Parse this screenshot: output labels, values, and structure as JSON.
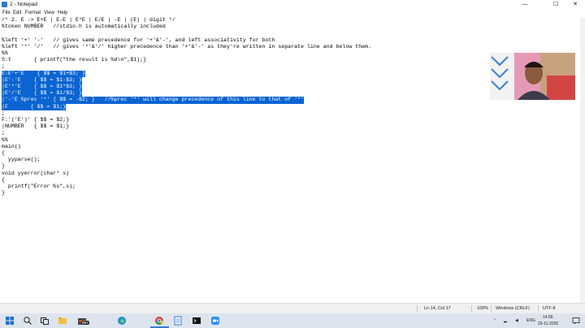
{
  "window": {
    "title": "2 - Notepad",
    "controls": [
      "—",
      "☐",
      "✕"
    ]
  },
  "menu": [
    "File",
    "Edit",
    "Format",
    "View",
    "Help"
  ],
  "editor": {
    "lines": [
      "/* 2. E -> E+E | E-E | E*E | E/E | -E | (E) | digit */",
      "%token NUMBER   //stdio.h is automatically included",
      "",
      "%left '+' '-'   // gives same precedence for '+'&'-', and left associativity for both",
      "%left '*' '/'   // gives '*'&'/' higher precedence than '+'&'-' as they're written in separate line and below them.",
      "%%",
      "S:t       { printf(\"the result is %d\\n\",$1);}",
      ";",
      "E:E'+'E    { $$ = $1+$3; }",
      "|E'-'E    { $$ = $1-$3; }",
      "|E'*'E    { $$ = $1*$3; }",
      "|E'/'E    { $$ = $1/$3; }",
      "|'-'E %prec '*' { $$ = -$2; }   //%prec '*' will change precedence of this line to that of '*'",
      "|F       { $$ = $1;}",
      ";",
      "F:'('E')' { $$ = $2;}",
      "|NUMBER   { $$ = $1;}",
      ";",
      "%%",
      "main()",
      "{",
      "  yyparse();",
      "}",
      "void yyerror(char* s)",
      "{",
      "  printf(\"Error %s\",s);",
      "}"
    ]
  },
  "status": {
    "position": "Ln 14, Col 17",
    "zoom": "100%",
    "line_ending": "Windows (CRLF)",
    "encoding": "UTF-8"
  },
  "taskbar": {
    "icons": [
      "windows-start-icon",
      "search-icon",
      "task-view-icon",
      "file-explorer-icon",
      "store-icon",
      "edge-icon",
      "chrome-icon",
      "notepad-icon",
      "terminal-icon",
      "zoom-icon"
    ],
    "badge": "99+",
    "lang": "ENG",
    "time": "14:56",
    "date": "29-11-2020"
  },
  "colors": {
    "selection": "#0a64d2",
    "taskbar": "#dde4ee",
    "statusbar": "#f0f0f0"
  }
}
